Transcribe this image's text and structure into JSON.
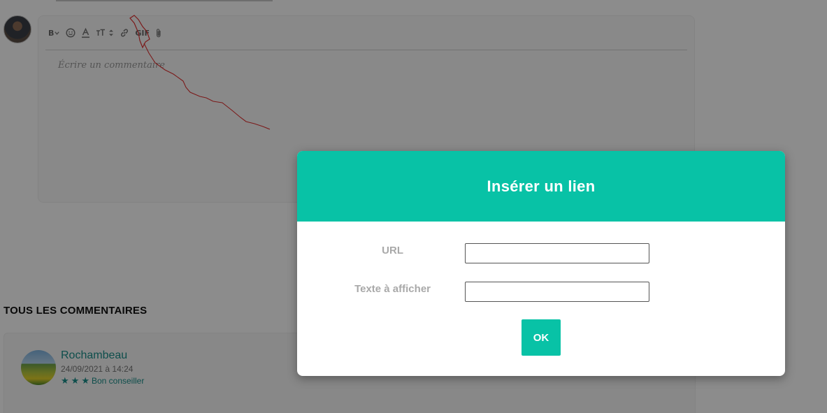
{
  "editor": {
    "placeholder": "Écrire un commentaire",
    "toolbar": {
      "bold_label": "B",
      "gif_label": "GIF",
      "icons": [
        "bold-icon",
        "chevron-down-icon",
        "emoji-icon",
        "text-color-icon",
        "font-size-icon",
        "stepper-icon",
        "link-icon",
        "gif-icon",
        "attachment-icon"
      ]
    }
  },
  "comments_section": {
    "title": "TOUS LES COMMENTAIRES"
  },
  "comment": {
    "author": "Rochambeau",
    "date": "24/09/2021 à 14:24",
    "stars": 3,
    "rank": "Bon conseiller"
  },
  "link_dialog": {
    "title": "Insérer un lien",
    "url_label": "URL",
    "url_value": "",
    "text_label": "Texte à afficher",
    "text_value": "",
    "ok_label": "OK"
  },
  "colors": {
    "accent": "#08c2a6",
    "link_name": "#1a8f8a",
    "annotation_stroke": "#e03030"
  }
}
